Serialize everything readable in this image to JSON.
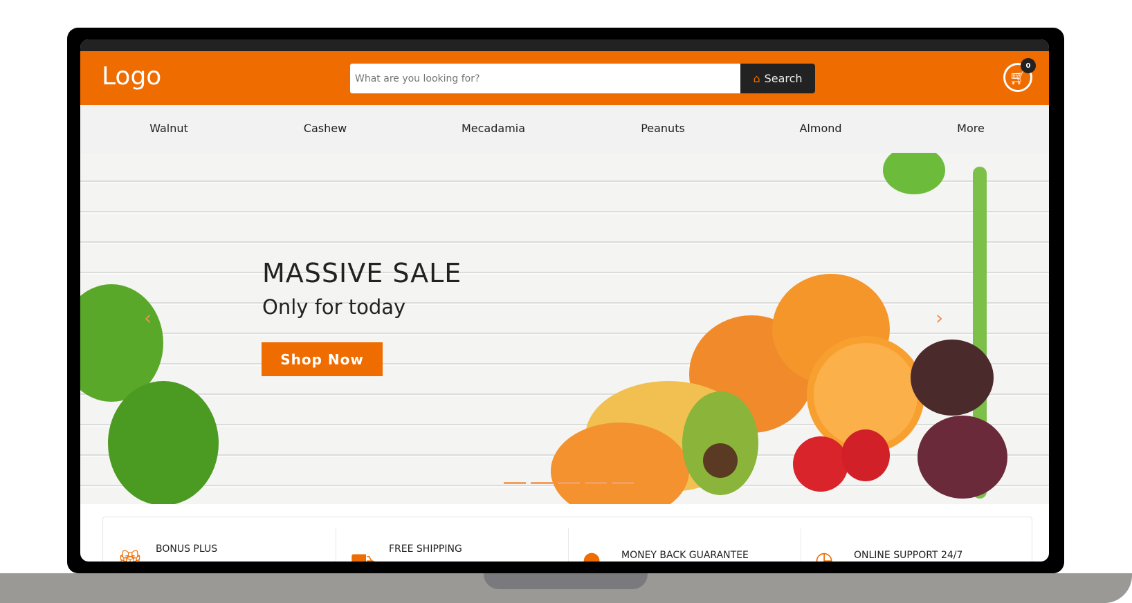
{
  "header": {
    "logo": "Logo",
    "search_placeholder": "What are you looking for?",
    "search_button": "Search",
    "cart_count": "0"
  },
  "nav": {
    "items": [
      "Walnut",
      "Cashew",
      "Mecadamia",
      "Peanuts",
      "Almond",
      "More"
    ]
  },
  "hero": {
    "title": "MASSIVE SALE",
    "subtitle": "Only for today",
    "button": "Shop Now",
    "slides": 5
  },
  "features": [
    {
      "title": "BONUS PLUS",
      "icon": "gift-icon"
    },
    {
      "title": "FREE SHIPPING",
      "icon": "truck-icon"
    },
    {
      "title": "MONEY BACK GUARANTEE",
      "icon": "money-icon"
    },
    {
      "title": "ONLINE SUPPORT 24/7",
      "icon": "clock-icon"
    }
  ],
  "colors": {
    "accent": "#ee6c00",
    "dark": "#222222"
  }
}
